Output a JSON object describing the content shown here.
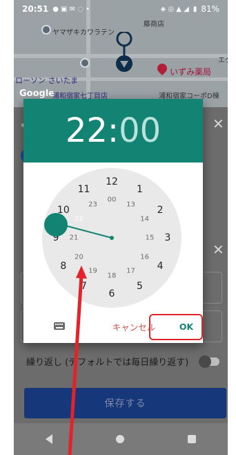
{
  "status_bar": {
    "time": "20:51",
    "battery": "81%"
  },
  "map": {
    "labels": {
      "l1": "ヤマザキカワラテン",
      "l2": "藤商店",
      "l3": "いずみ薬局",
      "l4": "ローソン さいたま",
      "l5": "浦和宿家七丁目店",
      "l6": "浦和宿家コーポD棟",
      "l7": "エク"
    },
    "google": "Google"
  },
  "background": {
    "repeat_label": "繰り返し (デフォルトでは毎日繰り返す)",
    "save_label": "保存する"
  },
  "dialog": {
    "hours": "22",
    "colon": ":",
    "minutes": "00",
    "cancel_label": "キャンセル",
    "ok_label": "OK",
    "outer_numbers": [
      "12",
      "1",
      "2",
      "3",
      "4",
      "5",
      "6",
      "7",
      "8",
      "9",
      "10",
      "11"
    ],
    "inner_numbers": [
      "00",
      "13",
      "14",
      "15",
      "16",
      "17",
      "18",
      "19",
      "20",
      "21",
      "22",
      "23"
    ],
    "selected_hour": "22"
  },
  "colors": {
    "accent": "#138474",
    "cancel": "#d24f4f",
    "annotation": "#e3232a"
  }
}
